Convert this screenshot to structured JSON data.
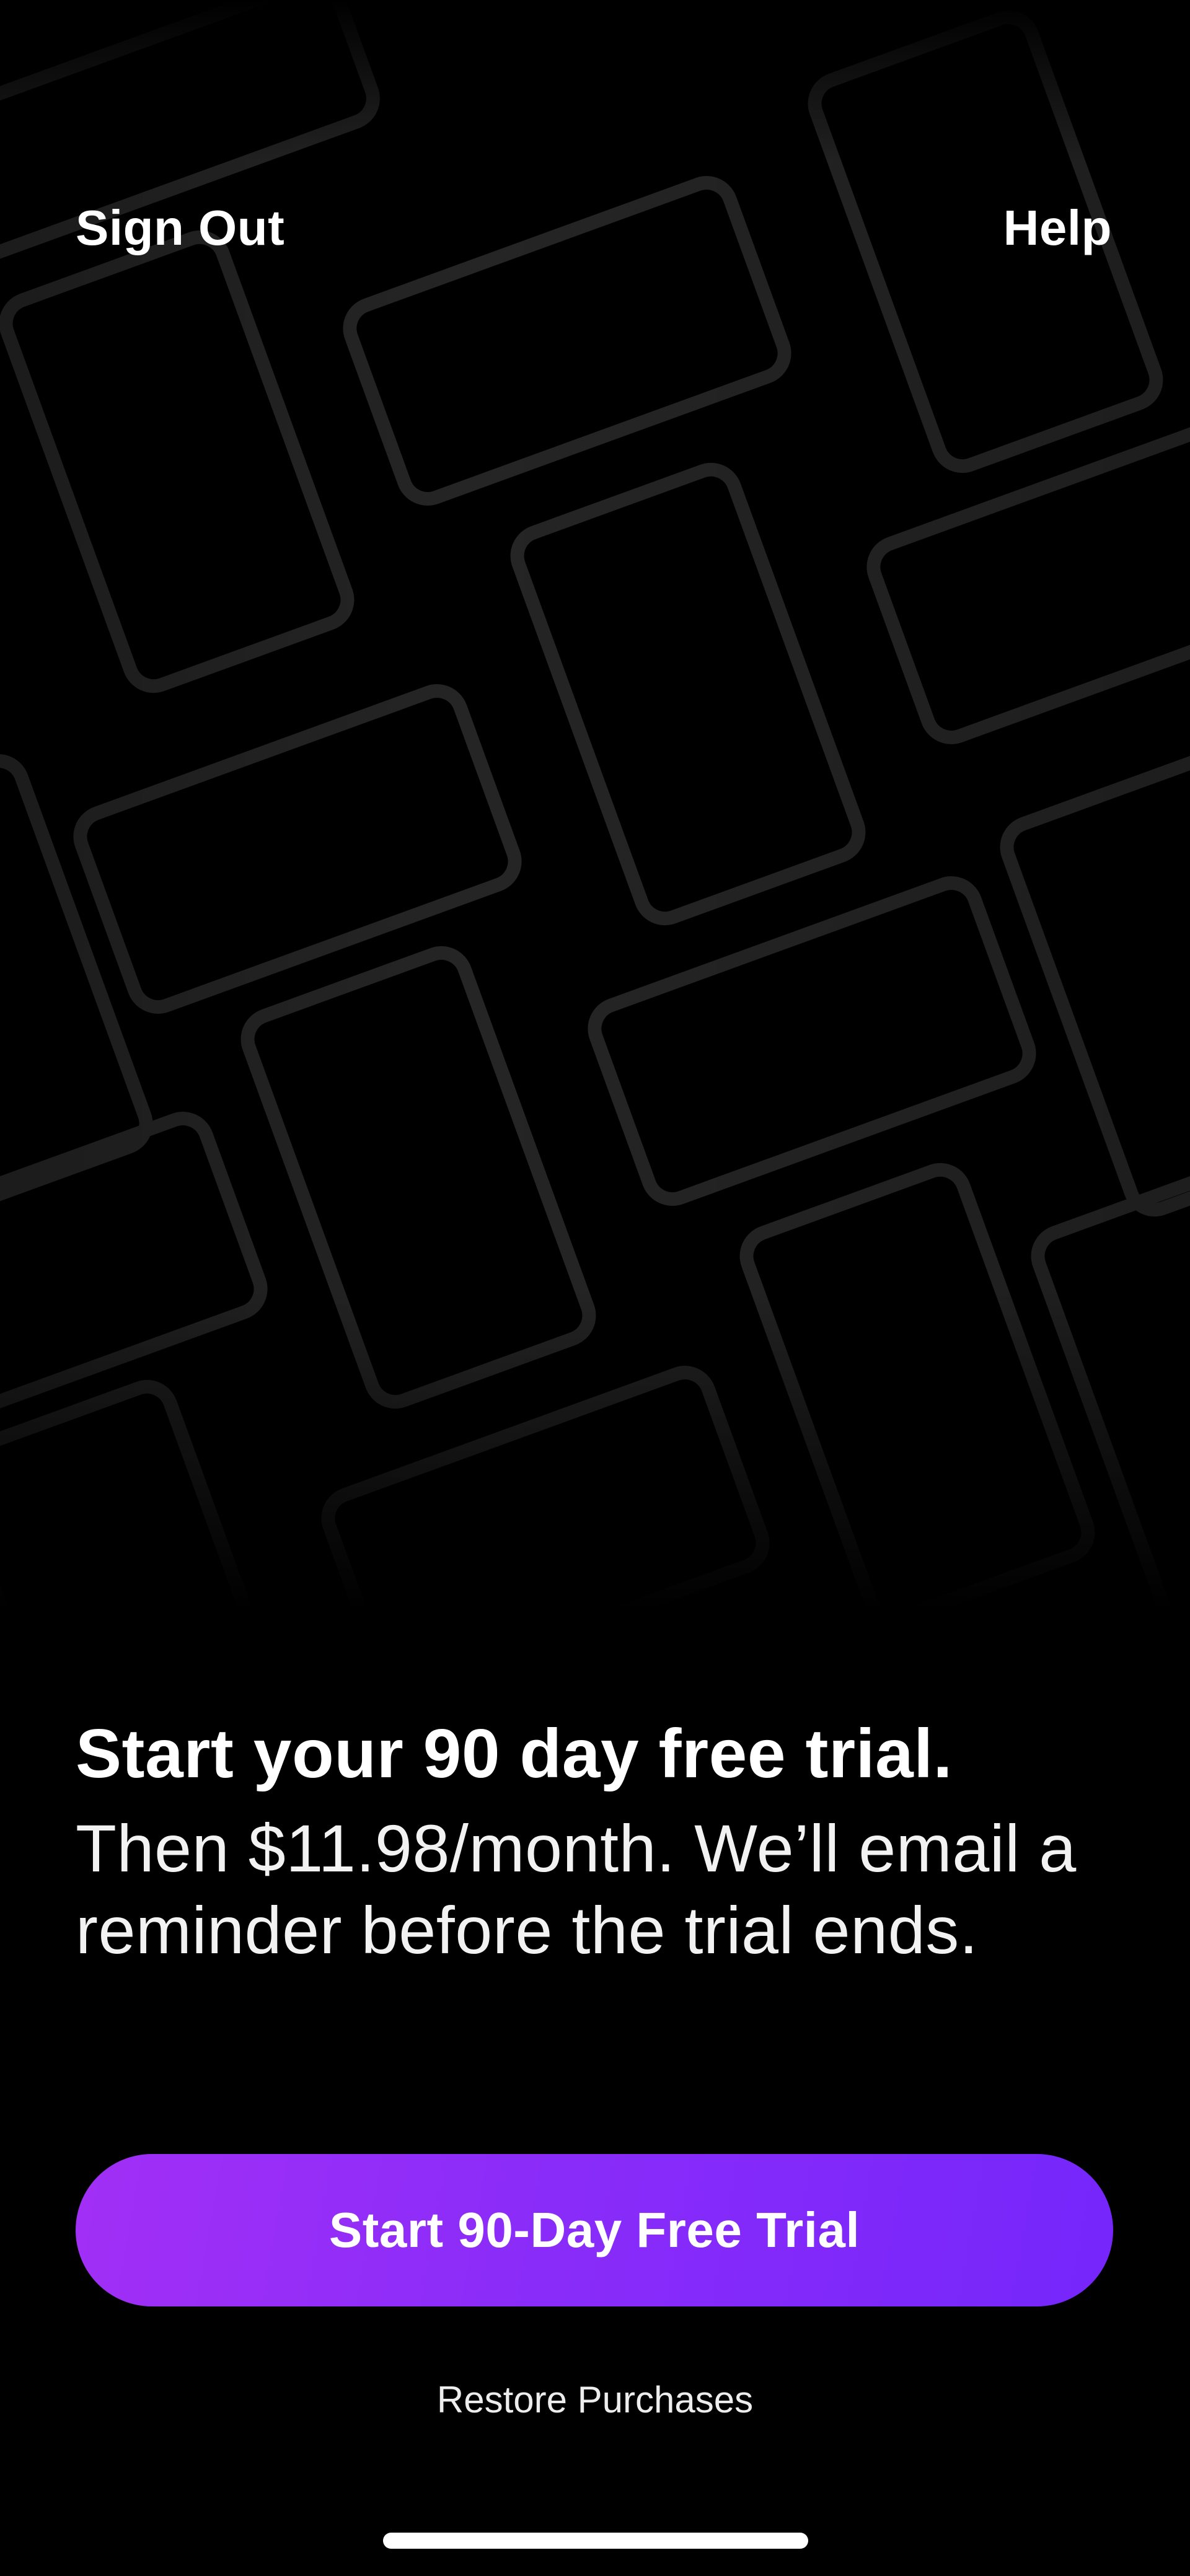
{
  "header": {
    "sign_out_label": "Sign Out",
    "help_label": "Help"
  },
  "offer": {
    "title": "Start your 90 day free trial.",
    "subtitle": "Then $11.98/month. We’ll email a reminder before the trial ends."
  },
  "cta": {
    "label": "Start 90-Day Free Trial"
  },
  "footer": {
    "restore_label": "Restore Purchases"
  },
  "colors": {
    "background": "#000000",
    "text": "#ffffff",
    "accent_start": "#a22ff6",
    "accent_end": "#7526fb",
    "pattern_outline": "#242424"
  },
  "icons": {
    "background_pattern": "tilted-device-outlines"
  }
}
